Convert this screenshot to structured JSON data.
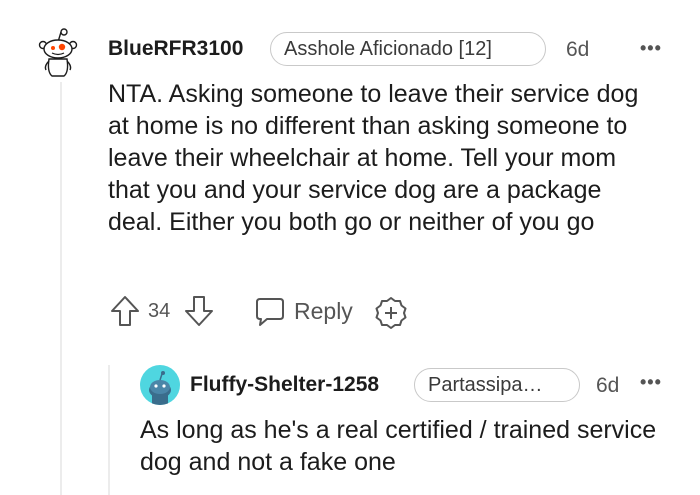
{
  "comment": {
    "username": "BlueRFR3100",
    "flair": "Asshole Aficionado [12]",
    "age": "6d",
    "more": "•••",
    "body": "NTA. Asking someone to leave their service dog at home is no different than asking someone to leave their wheelchair at home. Tell your mom that you and your service dog are a package deal. Either you both go or neither of you go",
    "votes": "34",
    "reply_label": "Reply"
  },
  "reply": {
    "username": "Fluffy-Shelter-1258",
    "flair": "Partassipa…",
    "age": "6d",
    "more": "•••",
    "body": "As long as he's a real certified / trained service dog and not a fake one"
  },
  "colors": {
    "text": "#1c1c1c",
    "muted": "#555555",
    "snoo_orange": "#ff4500",
    "avatar_teal": "#4fd6e0"
  }
}
